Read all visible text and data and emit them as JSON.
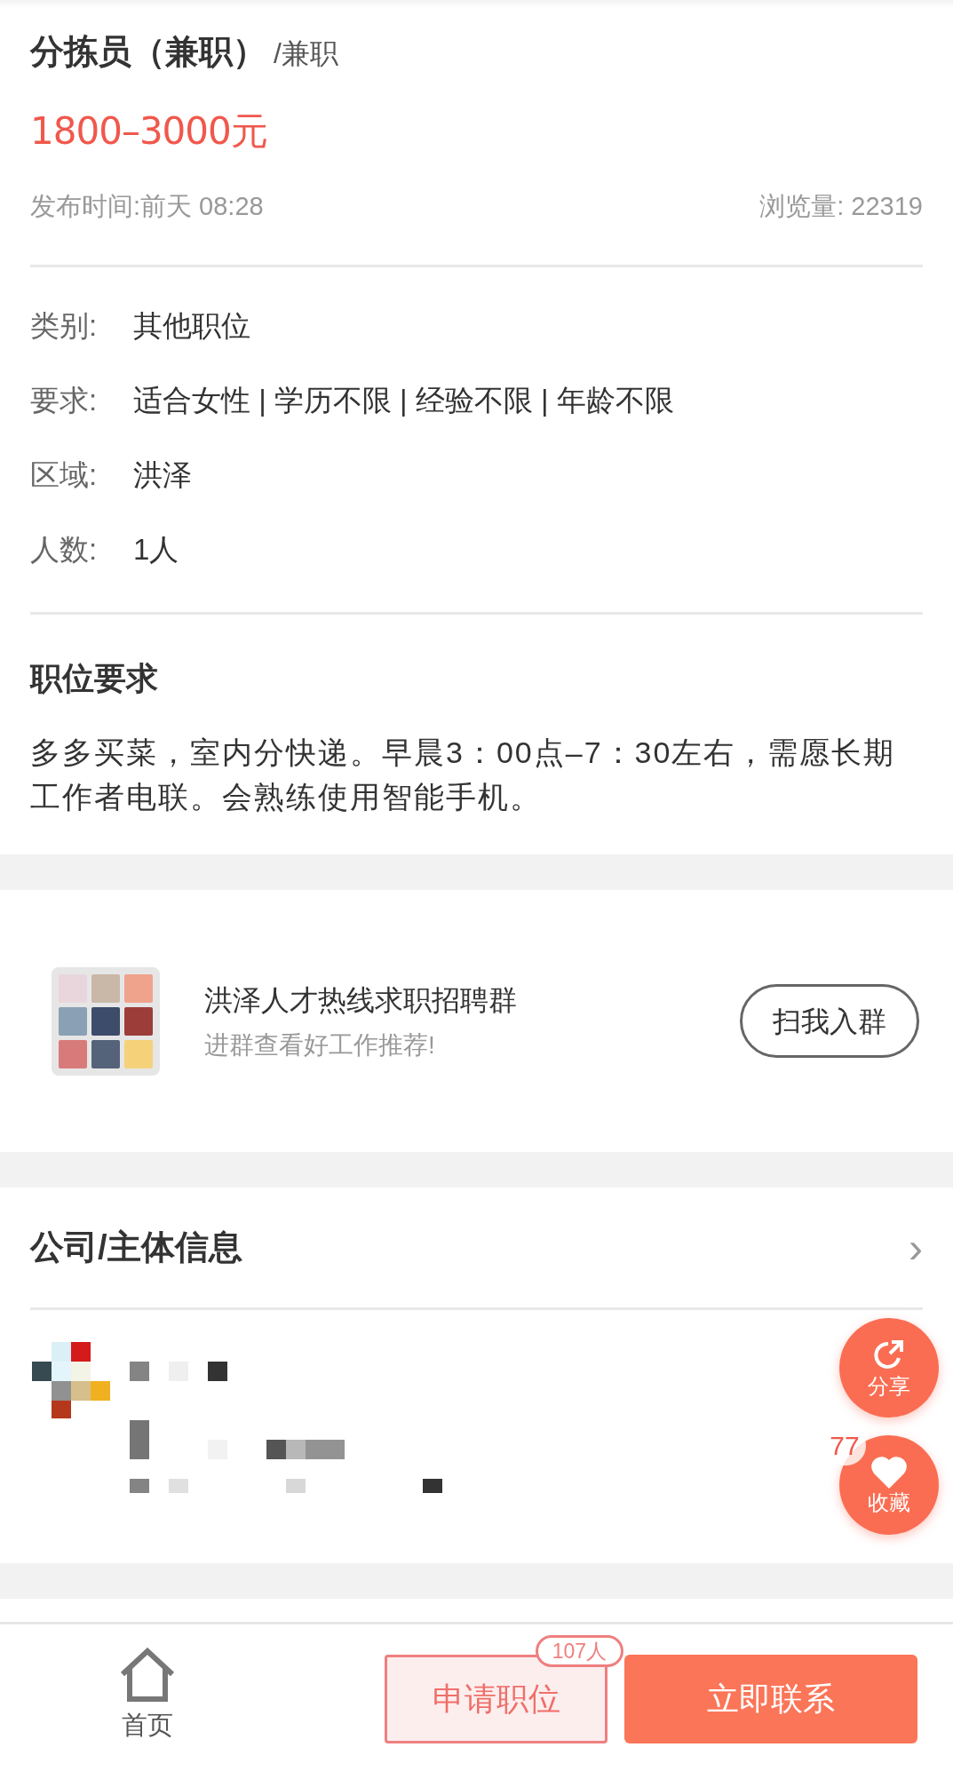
{
  "job": {
    "title": "分拣员（兼职）",
    "type": "/兼职",
    "salary": "1800–3000元",
    "published": "发布时间:前天 08:28",
    "views": "浏览量: 22319"
  },
  "details": [
    {
      "label": "类别:",
      "value": "其他职位"
    },
    {
      "label": "要求:",
      "value": "适合女性 | 学历不限 | 经验不限 | 年龄不限"
    },
    {
      "label": "区域:",
      "value": "洪泽"
    },
    {
      "label": "人数:",
      "value": "1人"
    }
  ],
  "requirements": {
    "heading": "职位要求",
    "text": "多多买菜，室内分快递。早晨3：00点–7：30左右，需愿长期工作者电联。会熟练使用智能手机。"
  },
  "group": {
    "name": "洪泽人才热线求职招聘群",
    "subtitle": "进群查看好工作推荐!",
    "button": "扫我入群"
  },
  "company": {
    "heading": "公司/主体信息",
    "chevron": "›"
  },
  "floating": [
    {
      "kind": "share",
      "label": "分享"
    },
    {
      "kind": "favorite",
      "label": "收藏",
      "count": "77"
    }
  ],
  "bottom_bar": {
    "home": "首页",
    "apply": "申请职位",
    "apply_badge": "107人",
    "contact": "立即联系"
  }
}
